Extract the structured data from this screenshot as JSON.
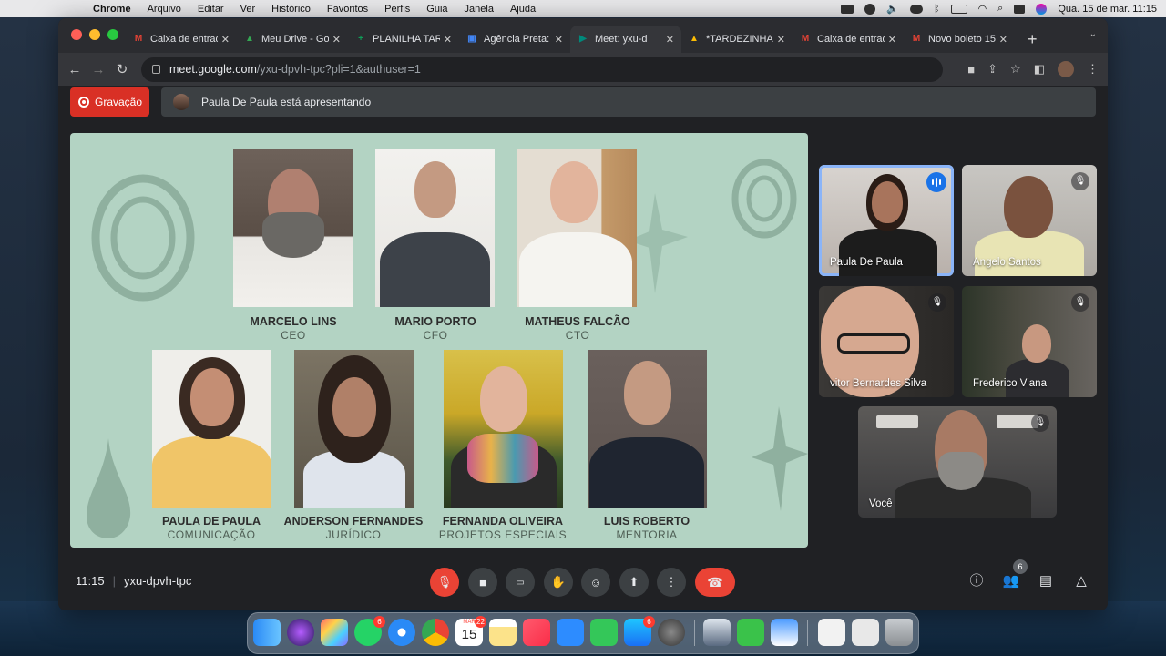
{
  "menubar": {
    "apple": "",
    "app": "Chrome",
    "items": [
      "Arquivo",
      "Editar",
      "Ver",
      "Histórico",
      "Favoritos",
      "Perfis",
      "Guia",
      "Janela",
      "Ajuda"
    ],
    "datetime": "Qua. 15 de mar.  11:15"
  },
  "browser": {
    "tabs": [
      {
        "icon": "gmail-icon",
        "label": "Caixa de entrad",
        "color": "#ea4335",
        "glyph": "M"
      },
      {
        "icon": "drive-icon",
        "label": "Meu Drive - Goo",
        "color": "#34a853",
        "glyph": "▲"
      },
      {
        "icon": "sheets-icon",
        "label": "PLANILHA TARE",
        "color": "#0f9d58",
        "glyph": "+"
      },
      {
        "icon": "calendar-icon",
        "label": "Agência Preta:",
        "color": "#4285f4",
        "glyph": "▣"
      },
      {
        "icon": "meet-icon",
        "label": "Meet: yxu-d",
        "color": "#00897b",
        "glyph": "▶"
      },
      {
        "icon": "drive-icon",
        "label": "*TARDEZINHA I",
        "color": "#fbbc04",
        "glyph": "▲"
      },
      {
        "icon": "gmail-icon",
        "label": "Caixa de entrad",
        "color": "#ea4335",
        "glyph": "M"
      },
      {
        "icon": "gmail-icon",
        "label": "Novo boleto 15/",
        "color": "#ea4335",
        "glyph": "M"
      }
    ],
    "new_tab": "+",
    "url_host": "meet.google.com",
    "url_path": "/yxu-dpvh-tpc?pli=1&authuser=1"
  },
  "meet": {
    "record_label": "Gravação",
    "presenting_text": "Paula De Paula está apresentando",
    "slide": {
      "people": [
        {
          "name": "MARCELO LINS",
          "role": "CEO"
        },
        {
          "name": "MARIO PORTO",
          "role": "CFO"
        },
        {
          "name": "MATHEUS FALCÃO",
          "role": "CTO"
        },
        {
          "name": "PAULA DE PAULA",
          "role": "COMUNICAÇÃO"
        },
        {
          "name": "ANDERSON FERNANDES",
          "role": "JURÍDICO"
        },
        {
          "name": "FERNANDA OLIVEIRA",
          "role": "PROJETOS ESPECIAIS"
        },
        {
          "name": "LUIS ROBERTO",
          "role": "MENTORIA"
        }
      ]
    },
    "participants": [
      {
        "name": "Paula De Paula",
        "speaking": true
      },
      {
        "name": "Angelo Santos",
        "muted": true
      },
      {
        "name": "vitor Bernardes Silva",
        "muted": true
      },
      {
        "name": "Frederico Viana",
        "muted": true
      },
      {
        "name": "Você",
        "muted": true
      }
    ],
    "time": "11:15",
    "meeting_code": "yxu-dpvh-tpc",
    "people_count": "6"
  },
  "dock": {
    "whatsapp_badge": "6",
    "calendar_month": "MAR",
    "calendar_day": "15",
    "calendar_badge": "22",
    "appstore_badge": "6"
  }
}
